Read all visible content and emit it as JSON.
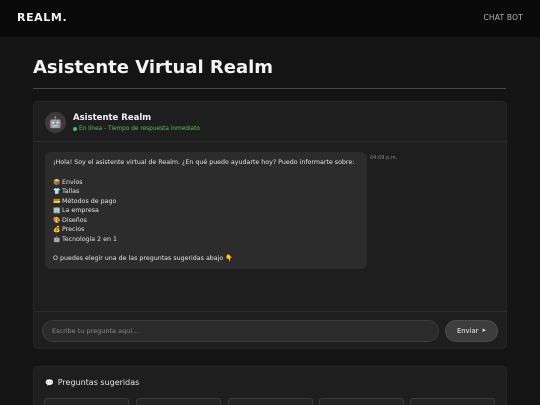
{
  "header": {
    "logo": "REALM.",
    "nav_chatbot": "CHAT BOT"
  },
  "page": {
    "title": "Asistente Virtual Realm"
  },
  "chat": {
    "avatar_icon": "robot-icon",
    "avatar_glyph": "🤖",
    "bot_name": "Asistente Realm",
    "status": "En línea - Tiempo de respuesta inmediato",
    "status_color": "#46c25a",
    "message": {
      "greeting": "¡Hola! Soy el asistente virtual de Realm. ¿En qué puedo ayudarte hoy? Puedo informarte sobre:",
      "topics": [
        {
          "icon": "package-icon",
          "glyph": "📦",
          "label": "Envíos"
        },
        {
          "icon": "tshirt-icon",
          "glyph": "👕",
          "label": "Tallas"
        },
        {
          "icon": "credit-card-icon",
          "glyph": "💳",
          "label": "Métodos de pago"
        },
        {
          "icon": "building-icon",
          "glyph": "🏢",
          "label": "La empresa"
        },
        {
          "icon": "palette-icon",
          "glyph": "🎨",
          "label": "Diseños"
        },
        {
          "icon": "money-bag-icon",
          "glyph": "💰",
          "label": "Precios"
        },
        {
          "icon": "robot-icon",
          "glyph": "🤖",
          "label": "Tecnología 2 en 1"
        }
      ],
      "closing": "O puedes elegir una de las preguntas sugeridas abajo",
      "closing_glyph": "👇",
      "time": "04:09 p.m."
    },
    "input_placeholder": "Escribe tu pregunta aquí...",
    "send_label": "Enviar",
    "send_glyph": "➤"
  },
  "suggestions": {
    "title": "Preguntas sugeridas",
    "icon": "speech-bubble-icon",
    "glyph": "💬"
  }
}
